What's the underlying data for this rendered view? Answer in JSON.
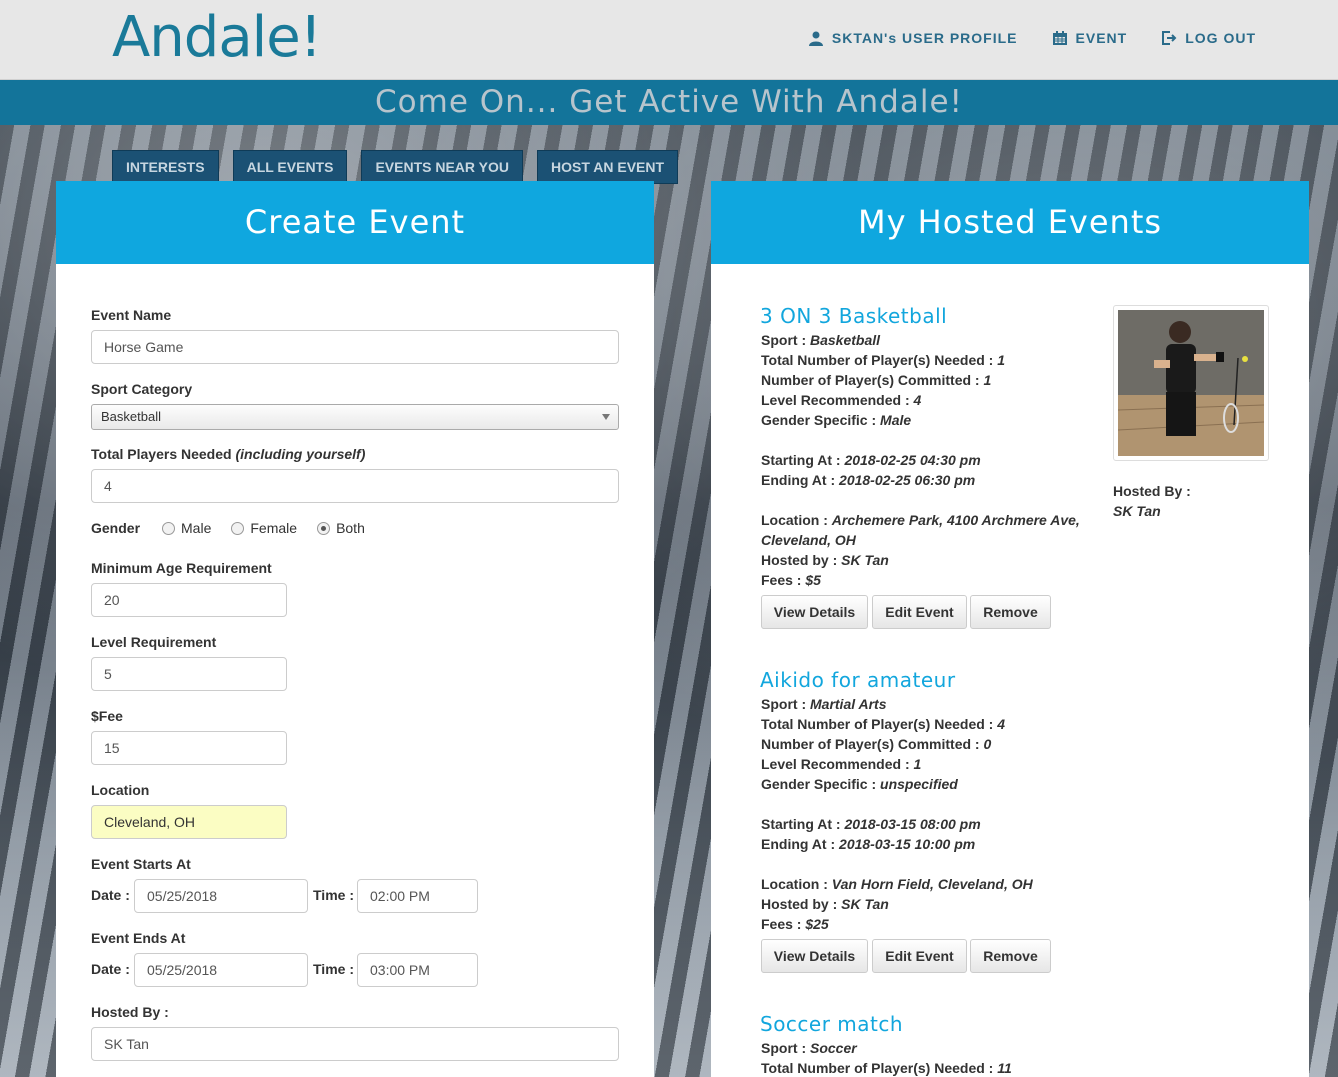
{
  "header": {
    "logo": "Andale!",
    "nav": [
      {
        "label": "SKTAN's USER PROFILE",
        "icon": "user-icon"
      },
      {
        "label": "EVENT",
        "icon": "calendar-icon"
      },
      {
        "label": "LOG OUT",
        "icon": "logout-icon"
      }
    ],
    "banner": "Come On... Get Active With Andale!"
  },
  "tabs": [
    "INTERESTS",
    "ALL EVENTS",
    "EVENTS NEAR YOU",
    "HOST AN EVENT"
  ],
  "create": {
    "title": "Create Event",
    "event_name_label": "Event Name",
    "event_name_value": "Horse Game",
    "sport_label": "Sport Category",
    "sport_value": "Basketball",
    "players_label": "Total Players Needed",
    "players_hint": "(including yourself)",
    "players_value": "4",
    "gender_label": "Gender",
    "gender_options": [
      "Male",
      "Female",
      "Both"
    ],
    "gender_selected": "Both",
    "min_age_label": "Minimum Age Requirement",
    "min_age_value": "20",
    "level_label": "Level Requirement",
    "level_value": "5",
    "fee_label": "$Fee",
    "fee_value": "15",
    "location_label": "Location",
    "location_value": "Cleveland, OH",
    "starts_label": "Event Starts At",
    "ends_label": "Event Ends At",
    "date_label": "Date :",
    "time_label": "Time :",
    "start_date": "05/25/2018",
    "start_time": "02:00  PM",
    "end_date": "05/25/2018",
    "end_time": "03:00  PM",
    "hosted_label": "Hosted By :",
    "hosted_value": "SK Tan"
  },
  "hosted": {
    "title": "My Hosted Events",
    "side_hosted_label": "Hosted By :",
    "side_hosted_value": "SK Tan",
    "labels": {
      "sport": "Sport : ",
      "total": "Total Number of Player(s) Needed : ",
      "committed": "Number of Player(s) Committed : ",
      "level": "Level Recommended : ",
      "gender": "Gender Specific : ",
      "start": "Starting At : ",
      "end": "Ending At : ",
      "location": "Location : ",
      "hosted": "Hosted by : ",
      "fees": "Fees : "
    },
    "buttons": {
      "view": "View Details",
      "edit": "Edit Event",
      "remove": "Remove"
    },
    "events": [
      {
        "name": "3 ON 3 Basketball",
        "sport": "Basketball",
        "total": "1",
        "committed": "1",
        "level": "4",
        "gender": "Male",
        "start": "2018-02-25 04:30 pm",
        "end": "2018-02-25 06:30 pm",
        "location_line1": "Archemere Park, 4100 Archmere Ave,",
        "location_line2": "Cleveland, OH",
        "hosted": "SK Tan",
        "fees": "$5"
      },
      {
        "name": "Aikido for amateur",
        "sport": "Martial Arts",
        "total": "4",
        "committed": "0",
        "level": "1",
        "gender": "unspecified",
        "start": "2018-03-15 08:00 pm",
        "end": "2018-03-15 10:00 pm",
        "location_line1": "Van Horn Field, Cleveland, OH",
        "hosted": "SK Tan",
        "fees": "$25"
      },
      {
        "name": "Soccer match",
        "sport": "Soccer",
        "total": "11"
      }
    ]
  }
}
